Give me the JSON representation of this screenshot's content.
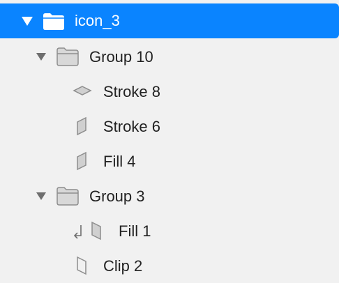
{
  "layers": {
    "root": {
      "label": "icon_3",
      "expanded": true,
      "selected": true,
      "icon": "folder-icon"
    },
    "group10": {
      "label": "Group 10",
      "expanded": true,
      "icon": "folder-icon"
    },
    "stroke8": {
      "label": "Stroke 8",
      "icon": "diamond-shape-icon"
    },
    "stroke6": {
      "label": "Stroke 6",
      "icon": "parallelogram-shape-icon"
    },
    "fill4": {
      "label": "Fill 4",
      "icon": "parallelogram-shape-icon"
    },
    "group3": {
      "label": "Group 3",
      "expanded": true,
      "icon": "folder-icon"
    },
    "fill1": {
      "label": "Fill 1",
      "icon": "parallelogram-shape-icon",
      "masked": true
    },
    "clip2": {
      "label": "Clip 2",
      "icon": "outline-parallelogram-icon"
    }
  },
  "colors": {
    "selection": "#0a84ff",
    "background": "#f1f1f1",
    "icon_gray": "#8e8e8e"
  }
}
